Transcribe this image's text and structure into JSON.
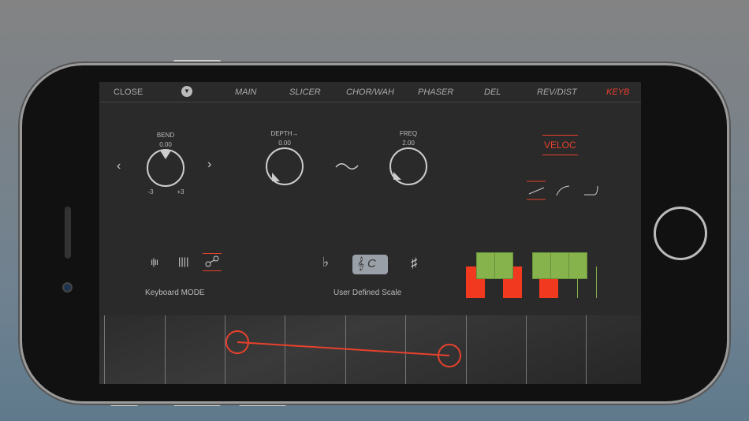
{
  "nav": {
    "close": "CLOSE",
    "tabs": [
      "MAIN",
      "SLICER",
      "CHOR/WAH",
      "PHASER",
      "DEL",
      "REV/DIST",
      "KEYB"
    ],
    "active": "KEYB"
  },
  "bend": {
    "label": "BEND",
    "value": "0.00",
    "min": "-3",
    "max": "+3"
  },
  "depth": {
    "label": "DEPTH→",
    "value": "0.00"
  },
  "freq": {
    "label": "FREQ",
    "value": "2.00"
  },
  "veloc": {
    "label": "VELOC"
  },
  "keyboard_mode": {
    "label": "Keyboard MODE"
  },
  "scale": {
    "label": "User Defined Scale",
    "key": "C",
    "flat": "♭",
    "sharp": "♯",
    "clef": "𝄞"
  },
  "colors": {
    "accent": "#e8412c",
    "green": "#86b34b",
    "red": "#f0391e"
  }
}
